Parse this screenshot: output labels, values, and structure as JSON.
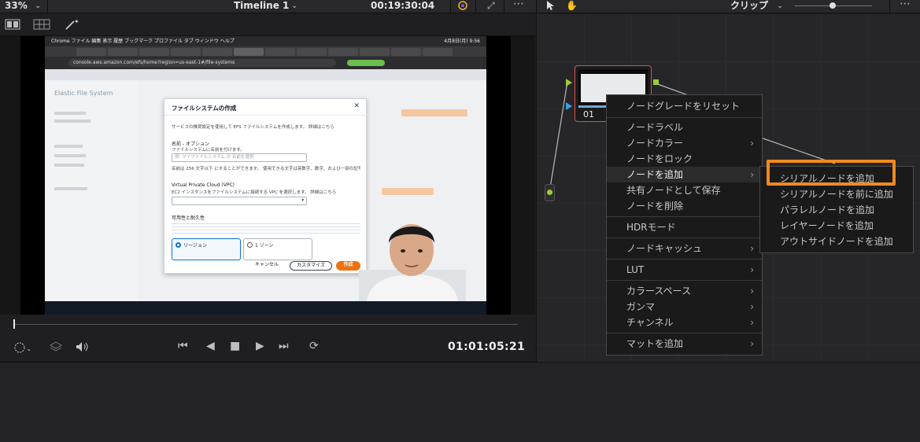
{
  "top_bar": {
    "zoom": "33%",
    "timeline_title": "Timeline 1",
    "timecode": "00:19:30:04",
    "clip_mode": "クリップ"
  },
  "viewer": {
    "screen": {
      "menubar": "  Chrome  ファイル  編集  表示  履歴  ブックマーク  プロファイル  タブ  ウィンドウ  ヘルプ",
      "menubar_time": "4月8日(月) 9:56",
      "url": "console.aws.amazon.com/efs/home?region=us-east-1#/file-systems",
      "sidebar_title": "Elastic File System",
      "dialog": {
        "title": "ファイルシステムの作成",
        "description": "サービスの推奨設定を使用して EFS ファイルシステムを作成します。 詳細はこちら",
        "name_label": "名前 - オプション",
        "name_sub": "ファイルシステムに名前を付けます。",
        "name_placeholder": "例: マイファイルシステム の 名前を選択",
        "name_hint": "名前は 256 文字以下 にすることができます。 使用できる文字は英数字、数字、および一部の記号です。",
        "vpc_label": "Virtual Private Cloud (VPC)",
        "vpc_sub": "EC2 インスタンスをファイルシステムに接続する VPC を選択します。 詳細はこちら",
        "availability_label": "可用性と耐久性",
        "option_regional": "リージョン",
        "option_one_zone": "1 ゾーン",
        "cancel": "キャンセル",
        "customize": "カスタマイズ",
        "create": "作成"
      }
    },
    "timecode_out": "01:01:05:21"
  },
  "node_graph": {
    "node_label": "01"
  },
  "context_menu": {
    "items": [
      {
        "label": "ノードグレードをリセット",
        "submenu": false
      },
      {
        "label": "ノードラベル",
        "submenu": false
      },
      {
        "label": "ノードカラー",
        "submenu": true
      },
      {
        "label": "ノードをロック",
        "submenu": false
      },
      {
        "label": "ノードを追加",
        "submenu": true,
        "active": true
      },
      {
        "label": "共有ノードとして保存",
        "submenu": false
      },
      {
        "label": "ノードを削除",
        "submenu": false
      },
      {
        "label": "HDRモード",
        "submenu": false
      },
      {
        "label": "ノードキャッシュ",
        "submenu": true
      },
      {
        "label": "LUT",
        "submenu": true
      },
      {
        "label": "カラースペース",
        "submenu": true
      },
      {
        "label": "ガンマ",
        "submenu": true
      },
      {
        "label": "チャンネル",
        "submenu": true
      },
      {
        "label": "マットを追加",
        "submenu": true
      }
    ]
  },
  "submenu": {
    "items": [
      "シリアルノードを追加",
      "シリアルノードを前に追加",
      "パラレルノードを追加",
      "レイヤーノードを追加",
      "アウトサイドノードを追加"
    ]
  },
  "colors": {
    "highlight": "#f08b1d",
    "node_border": "#e05050",
    "node_connector": "#9ccc3a",
    "node_input_blue": "#3aa0e0"
  }
}
